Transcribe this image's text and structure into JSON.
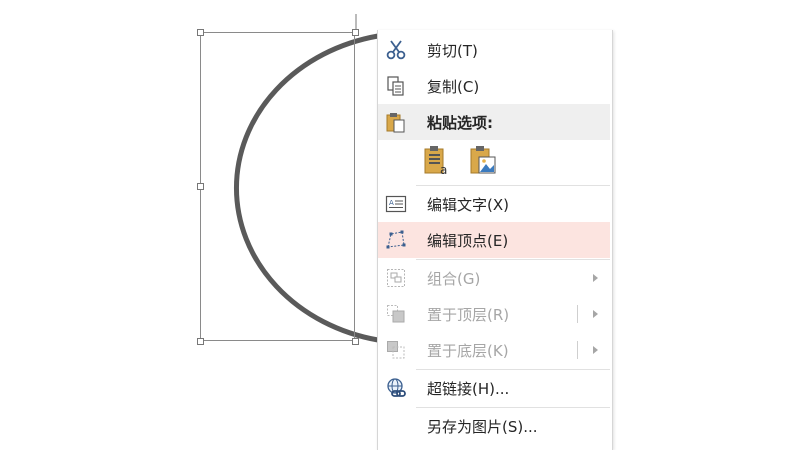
{
  "context_menu": {
    "cut": "剪切(T)",
    "copy": "复制(C)",
    "paste_options": "粘贴选项:",
    "edit_text": "编辑文字(X)",
    "edit_points": "编辑顶点(E)",
    "group": "组合(G)",
    "bring_to_front": "置于顶层(R)",
    "send_to_back": "置于底层(K)",
    "hyperlink": "超链接(H)...",
    "save_as_picture": "另存为图片(S)..."
  },
  "paste_buttons": [
    {
      "icon": "paste-text-only-icon"
    },
    {
      "icon": "paste-as-picture-icon"
    }
  ],
  "colors": {
    "arc_stroke": "#5a5a5a",
    "hover_bg": "#fce4e0",
    "header_bg": "#efefef",
    "disabled_text": "#a6a6a6"
  }
}
